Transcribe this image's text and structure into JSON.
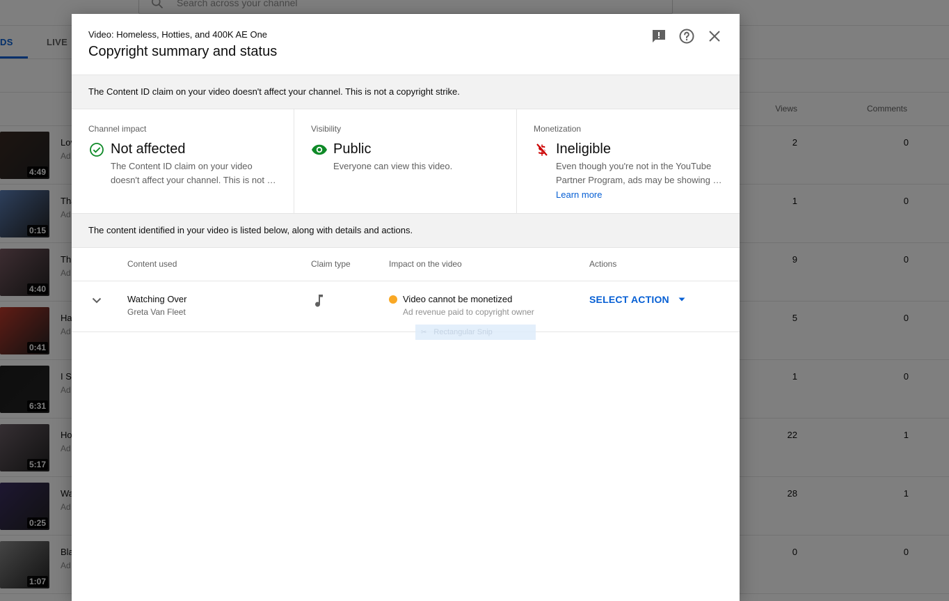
{
  "background": {
    "search_placeholder": "Search across your channel",
    "tabs": [
      {
        "label": "DS",
        "active": true
      },
      {
        "label": "LIVE",
        "active": false
      }
    ],
    "columns": {
      "views": "Views",
      "comments": "Comments"
    },
    "rows": [
      {
        "title": "Lov",
        "sub": "Ad",
        "duration": "4:49",
        "views": "2",
        "comments": "0",
        "thumb": "#3a2a22"
      },
      {
        "title": "Tha",
        "sub": "Ad",
        "duration": "0:15",
        "views": "1",
        "comments": "0",
        "thumb": "#5b7fb8"
      },
      {
        "title": "Thi",
        "sub": "Ad",
        "duration": "4:40",
        "views": "9",
        "comments": "0",
        "thumb": "#7a5a63"
      },
      {
        "title": "Ha",
        "sub": "Ad",
        "duration": "0:41",
        "views": "5",
        "comments": "0",
        "thumb": "#c0392b"
      },
      {
        "title": "I Sl",
        "sub": "Ad",
        "duration": "6:31",
        "views": "1",
        "comments": "0",
        "thumb": "#1d1d1d"
      },
      {
        "title": "Ho",
        "sub": "Ad",
        "duration": "5:17",
        "views": "22",
        "comments": "1",
        "thumb": "#6b5e66"
      },
      {
        "title": "Wa",
        "sub": "Ad",
        "duration": "0:25",
        "views": "28",
        "comments": "1",
        "thumb": "#3b2e63"
      },
      {
        "title": "Bla",
        "sub": "Ad",
        "duration": "1:07",
        "views": "0",
        "comments": "0",
        "thumb": "#8a8a8a"
      }
    ]
  },
  "dialog": {
    "video_label": "Video: Homeless, Hotties, and 400K AE One",
    "title": "Copyright summary and status",
    "header_icons": [
      "feedback-icon",
      "help-icon",
      "close-icon"
    ],
    "notice_top": "The Content ID claim on your video doesn't affect your channel. This is not a copyright strike.",
    "cards": {
      "channel_impact": {
        "label": "Channel impact",
        "value": "Not affected",
        "desc_line1": "The Content ID claim on your video",
        "desc_line2": "doesn't affect your channel. This is not a copyright strike.",
        "icon": "check-circle-icon",
        "color": "#0f8a28"
      },
      "visibility": {
        "label": "Visibility",
        "value": "Public",
        "desc_line1": "Everyone can view this video.",
        "icon": "eye-icon",
        "color": "#0f8a28"
      },
      "monetization": {
        "label": "Monetization",
        "value": "Ineligible",
        "desc_line1": "Even though you're not in the YouTube",
        "desc_line2": "Partner Program, ads may be showing on your video.",
        "link": "Learn more",
        "icon": "no-money-icon",
        "color": "#cc0000"
      }
    },
    "notice_middle": "The content identified in your video is listed below, along with details and actions.",
    "table": {
      "columns": {
        "content": "Content used",
        "claim_type": "Claim type",
        "impact": "Impact on the video",
        "actions": "Actions"
      },
      "rows": [
        {
          "content_name": "Watching Over",
          "content_artist": "Greta Van Fleet",
          "claim_type_icon": "music-note-icon",
          "impact_main": "Video cannot be monetized",
          "impact_sub": "Ad revenue paid to copyright owner",
          "impact_color": "#f9a825",
          "action_label": "SELECT ACTION"
        }
      ]
    },
    "snip_overlay": "Rectangular Snip"
  }
}
